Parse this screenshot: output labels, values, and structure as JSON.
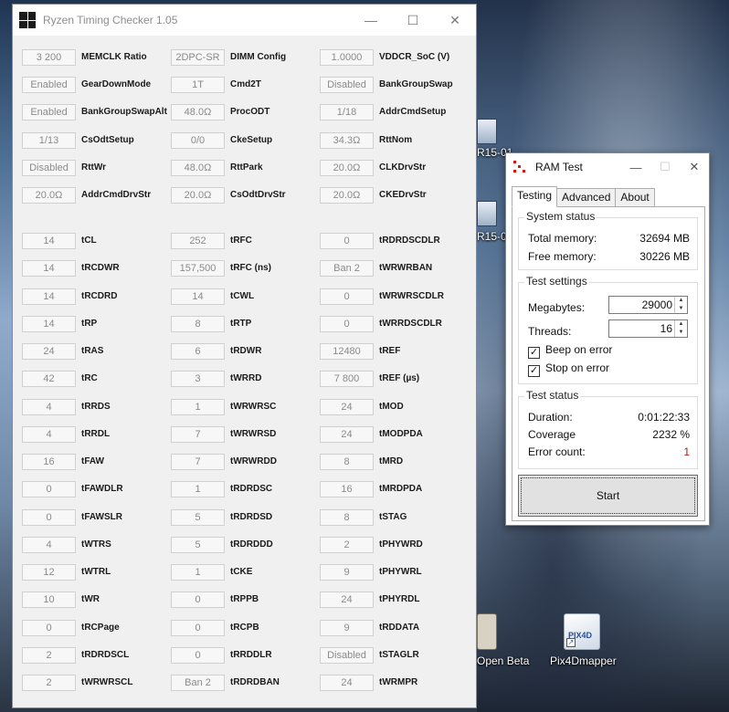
{
  "ryzen": {
    "title": "Ryzen Timing Checker 1.05",
    "minimize": "—",
    "maximize": "☐",
    "close": "✕",
    "config": [
      [
        {
          "value": "3 200",
          "label": "MEMCLK Ratio"
        },
        {
          "value": "2DPC-SR",
          "label": "DIMM Config"
        },
        {
          "value": "1.0000",
          "label": "VDDCR_SoC (V)"
        }
      ],
      [
        {
          "value": "Enabled",
          "label": "GearDownMode"
        },
        {
          "value": "1T",
          "label": "Cmd2T"
        },
        {
          "value": "Disabled",
          "label": "BankGroupSwap"
        }
      ],
      [
        {
          "value": "Enabled",
          "label": "BankGroupSwapAlt"
        },
        {
          "value": "48.0Ω",
          "label": "ProcODT"
        },
        {
          "value": "1/18",
          "label": "AddrCmdSetup"
        }
      ],
      [
        {
          "value": "1/13",
          "label": "CsOdtSetup"
        },
        {
          "value": "0/0",
          "label": "CkeSetup"
        },
        {
          "value": "34.3Ω",
          "label": "RttNom"
        }
      ],
      [
        {
          "value": "Disabled",
          "label": "RttWr"
        },
        {
          "value": "48.0Ω",
          "label": "RttPark"
        },
        {
          "value": "20.0Ω",
          "label": "CLKDrvStr"
        }
      ],
      [
        {
          "value": "20.0Ω",
          "label": "AddrCmdDrvStr"
        },
        {
          "value": "20.0Ω",
          "label": "CsOdtDrvStr"
        },
        {
          "value": "20.0Ω",
          "label": "CKEDrvStr"
        }
      ]
    ],
    "timings": [
      [
        {
          "value": "14",
          "label": "tCL"
        },
        {
          "value": "252",
          "label": "tRFC"
        },
        {
          "value": "0",
          "label": "tRDRDSCDLR"
        }
      ],
      [
        {
          "value": "14",
          "label": "tRCDWR"
        },
        {
          "value": "157,500",
          "label": "tRFC (ns)"
        },
        {
          "value": "Ban 2",
          "label": "tWRWRBAN"
        }
      ],
      [
        {
          "value": "14",
          "label": "tRCDRD"
        },
        {
          "value": "14",
          "label": "tCWL"
        },
        {
          "value": "0",
          "label": "tWRWRSCDLR"
        }
      ],
      [
        {
          "value": "14",
          "label": "tRP"
        },
        {
          "value": "8",
          "label": "tRTP"
        },
        {
          "value": "0",
          "label": "tWRRDSCDLR"
        }
      ],
      [
        {
          "value": "24",
          "label": "tRAS"
        },
        {
          "value": "6",
          "label": "tRDWR"
        },
        {
          "value": "12480",
          "label": "tREF"
        }
      ],
      [
        {
          "value": "42",
          "label": "tRC"
        },
        {
          "value": "3",
          "label": "tWRRD"
        },
        {
          "value": "7 800",
          "label": "tREF (µs)"
        }
      ],
      [
        {
          "value": "4",
          "label": "tRRDS"
        },
        {
          "value": "1",
          "label": "tWRWRSC"
        },
        {
          "value": "24",
          "label": "tMOD"
        }
      ],
      [
        {
          "value": "4",
          "label": "tRRDL"
        },
        {
          "value": "7",
          "label": "tWRWRSD"
        },
        {
          "value": "24",
          "label": "tMODPDA"
        }
      ],
      [
        {
          "value": "16",
          "label": "tFAW"
        },
        {
          "value": "7",
          "label": "tWRWRDD"
        },
        {
          "value": "8",
          "label": "tMRD"
        }
      ],
      [
        {
          "value": "0",
          "label": "tFAWDLR"
        },
        {
          "value": "1",
          "label": "tRDRDSC"
        },
        {
          "value": "16",
          "label": "tMRDPDA"
        }
      ],
      [
        {
          "value": "0",
          "label": "tFAWSLR"
        },
        {
          "value": "5",
          "label": "tRDRDSD"
        },
        {
          "value": "8",
          "label": "tSTAG"
        }
      ],
      [
        {
          "value": "4",
          "label": "tWTRS"
        },
        {
          "value": "5",
          "label": "tRDRDDD"
        },
        {
          "value": "2",
          "label": "tPHYWRD"
        }
      ],
      [
        {
          "value": "12",
          "label": "tWTRL"
        },
        {
          "value": "1",
          "label": "tCKE"
        },
        {
          "value": "9",
          "label": "tPHYWRL"
        }
      ],
      [
        {
          "value": "10",
          "label": "tWR"
        },
        {
          "value": "0",
          "label": "tRPPB"
        },
        {
          "value": "24",
          "label": "tPHYRDL"
        }
      ],
      [
        {
          "value": "0",
          "label": "tRCPage"
        },
        {
          "value": "0",
          "label": "tRCPB"
        },
        {
          "value": "9",
          "label": "tRDDATA"
        }
      ],
      [
        {
          "value": "2",
          "label": "tRDRDSCL"
        },
        {
          "value": "0",
          "label": "tRRDDLR"
        },
        {
          "value": "Disabled",
          "label": "tSTAGLR"
        }
      ],
      [
        {
          "value": "2",
          "label": "tWRWRSCL"
        },
        {
          "value": "Ban 2",
          "label": "tRDRDBAN"
        },
        {
          "value": "24",
          "label": "tWRMPR"
        }
      ]
    ]
  },
  "ramtest": {
    "title": "RAM Test",
    "minimize": "—",
    "maximize": "☐",
    "close": "✕",
    "tabs": [
      "Testing",
      "Advanced",
      "About"
    ],
    "system_status": {
      "title": "System status",
      "total_label": "Total memory:",
      "total_value": "32694 MB",
      "free_label": "Free memory:",
      "free_value": "30226 MB"
    },
    "test_settings": {
      "title": "Test settings",
      "megabytes_label": "Megabytes:",
      "megabytes_value": "29000",
      "threads_label": "Threads:",
      "threads_value": "16",
      "beep_label": "Beep on error",
      "beep_checked": true,
      "stop_label": "Stop on error",
      "stop_checked": true
    },
    "test_status": {
      "title": "Test status",
      "duration_label": "Duration:",
      "duration_value": "0:01:22:33",
      "coverage_label": "Coverage",
      "coverage_value": "2232 %",
      "errors_label": "Error count:",
      "errors_value": "1",
      "error_color": "#c41a1a"
    },
    "start_label": "Start"
  },
  "desktop": {
    "icon1_label": "R15-01",
    "icon2_label": "R15-0",
    "openbeta_label": "Open Beta",
    "pix4d_label": "Pix4Dmapper",
    "pix4d_badge": "PIX4D"
  }
}
